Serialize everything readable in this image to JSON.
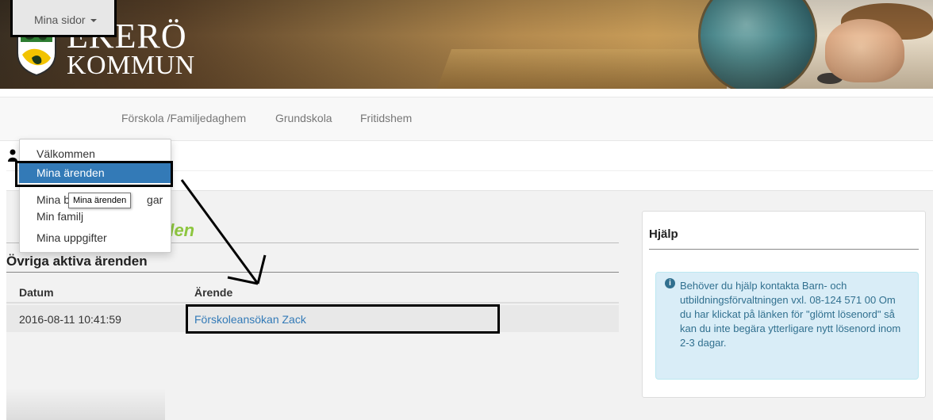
{
  "brand": {
    "line1": "EKERÖ",
    "line2": "KOMMUN"
  },
  "nav": {
    "mina_sidor": "Mina sidor",
    "forskola": "Förskola /Familjedaghem",
    "grundskola": "Grundskola",
    "fritidshem": "Fritidshem"
  },
  "dropdown": {
    "items": [
      "Välkommen",
      "Mina ärenden",
      "Mina b",
      "Min familj",
      "Mina uppgifter"
    ],
    "item3_suffix": "gar",
    "tooltip": "Mina ärenden"
  },
  "main": {
    "heading_partial": "den",
    "subheading": "Övriga aktiva ärenden",
    "columns": [
      "Datum",
      "Ärende"
    ],
    "rows": [
      {
        "datum": "2016-08-11 10:41:59",
        "arende": "Förskoleansökan Zack"
      }
    ]
  },
  "help": {
    "title": "Hjälp",
    "text": "Behöver du hjälp kontakta Barn- och utbildningsförvaltningen vxl. 08-124 571 00 Om du har klickat på länken för \"glömt lösenord\" så kan du inte begära ytterligare nytt lösenord inom 2-3 dagar."
  },
  "colors": {
    "accent_green": "#8dc63f",
    "link_blue": "#337ab7",
    "active_blue": "#337ab7",
    "alert_bg": "#d9edf7",
    "alert_text": "#31708f"
  },
  "icons": {
    "user": "user-icon",
    "info": "info-circle-icon",
    "caret": "caret-down-icon"
  }
}
